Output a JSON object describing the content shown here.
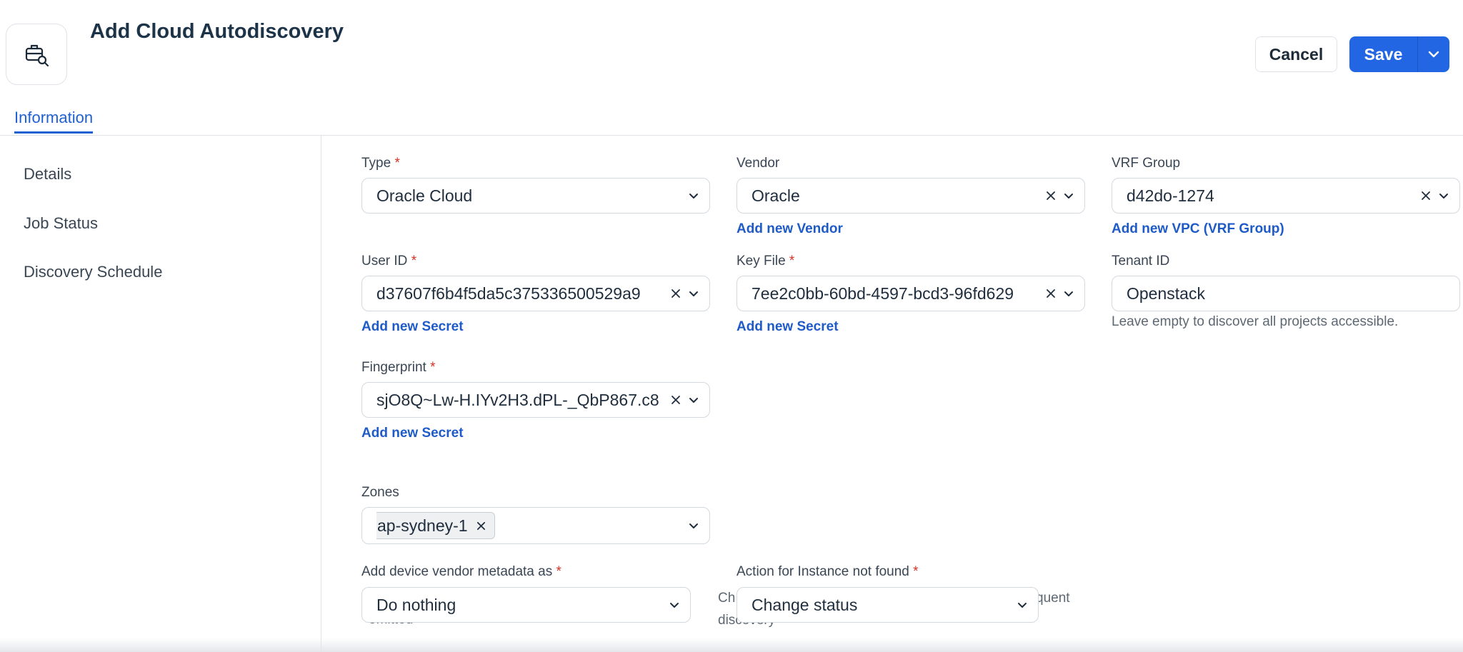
{
  "header": {
    "title": "Add Cloud Autodiscovery",
    "cancel_label": "Cancel",
    "save_label": "Save",
    "icon": "briefcase-search-icon"
  },
  "tabs": [
    {
      "label": "Information",
      "active": true
    }
  ],
  "sidebar": {
    "items": [
      {
        "label": "Details"
      },
      {
        "label": "Job Status"
      },
      {
        "label": "Discovery Schedule"
      }
    ]
  },
  "form": {
    "type": {
      "label": "Type",
      "required": true,
      "value": "Oracle Cloud"
    },
    "vendor": {
      "label": "Vendor",
      "required": false,
      "value": "Oracle",
      "link": "Add new Vendor"
    },
    "vrf_group": {
      "label": "VRF Group",
      "required": false,
      "value": "d42do-1274",
      "link": "Add new VPC (VRF Group)"
    },
    "user_id": {
      "label": "User ID",
      "required": true,
      "value": "d37607f6b4f5da5c375336500529a9",
      "link": "Add new Secret"
    },
    "key_file": {
      "label": "Key File",
      "required": true,
      "value": "7ee2c0bb-60bd-4597-bcd3-96fd629",
      "link": "Add new Secret"
    },
    "tenant_id": {
      "label": "Tenant ID",
      "required": false,
      "value": "Openstack",
      "help": "Leave empty to discover all projects accessible."
    },
    "fingerprint": {
      "label": "Fingerprint",
      "required": true,
      "value": "sjO8Q~Lw-H.IYv2H3.dPL-_QbP867.c8",
      "link": "Add new Secret"
    },
    "zones": {
      "label": "Zones",
      "required": false,
      "chips": [
        "ap-sydney-1"
      ]
    },
    "vendor_metadata": {
      "label": "Add device vendor metadata as",
      "required": true,
      "value": "Do nothing",
      "hint_fragment": "omitted"
    },
    "instance_not_found": {
      "label": "Action for Instance not found",
      "required": true,
      "value": "Change status",
      "hint_fragment_1": "Ch",
      "hint_fragment_2": "quent",
      "hint_fragment_3": "discovery"
    }
  },
  "colors": {
    "accent": "#2266e3",
    "link": "#1f5bc7",
    "required": "#d93025",
    "border": "#d4d9df"
  }
}
